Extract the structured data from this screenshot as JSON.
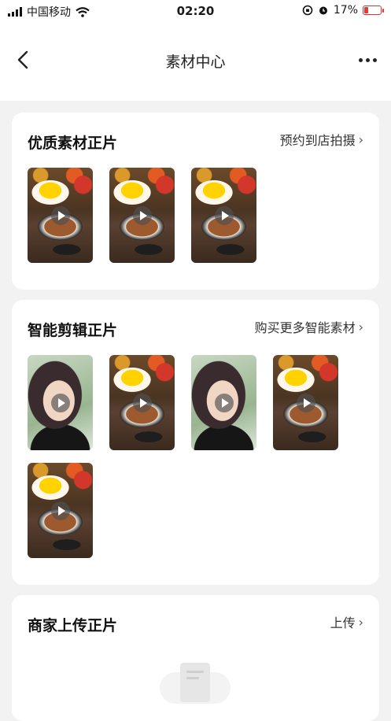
{
  "status_bar": {
    "carrier": "中国移动",
    "time": "02:20",
    "battery": "17%",
    "icons": [
      "signal-icon",
      "wifi-icon",
      "orientation-lock-icon",
      "alarm-icon",
      "battery-icon"
    ]
  },
  "nav": {
    "title": "素材中心",
    "back_icon": "chevron-left-icon",
    "more_icon": "more-dots-icon"
  },
  "sections": [
    {
      "title": "优质素材正片",
      "link": "预约到店拍摄",
      "thumbs": [
        "food",
        "food",
        "food"
      ]
    },
    {
      "title": "智能剪辑正片",
      "link": "购买更多智能素材",
      "thumbs": [
        "person",
        "food",
        "person",
        "food",
        "food"
      ]
    },
    {
      "title": "商家上传正片",
      "link": "上传",
      "thumbs": []
    }
  ],
  "colors": {
    "background": "#f2f2f2",
    "card": "#ffffff",
    "battery_low": "#e53935"
  }
}
